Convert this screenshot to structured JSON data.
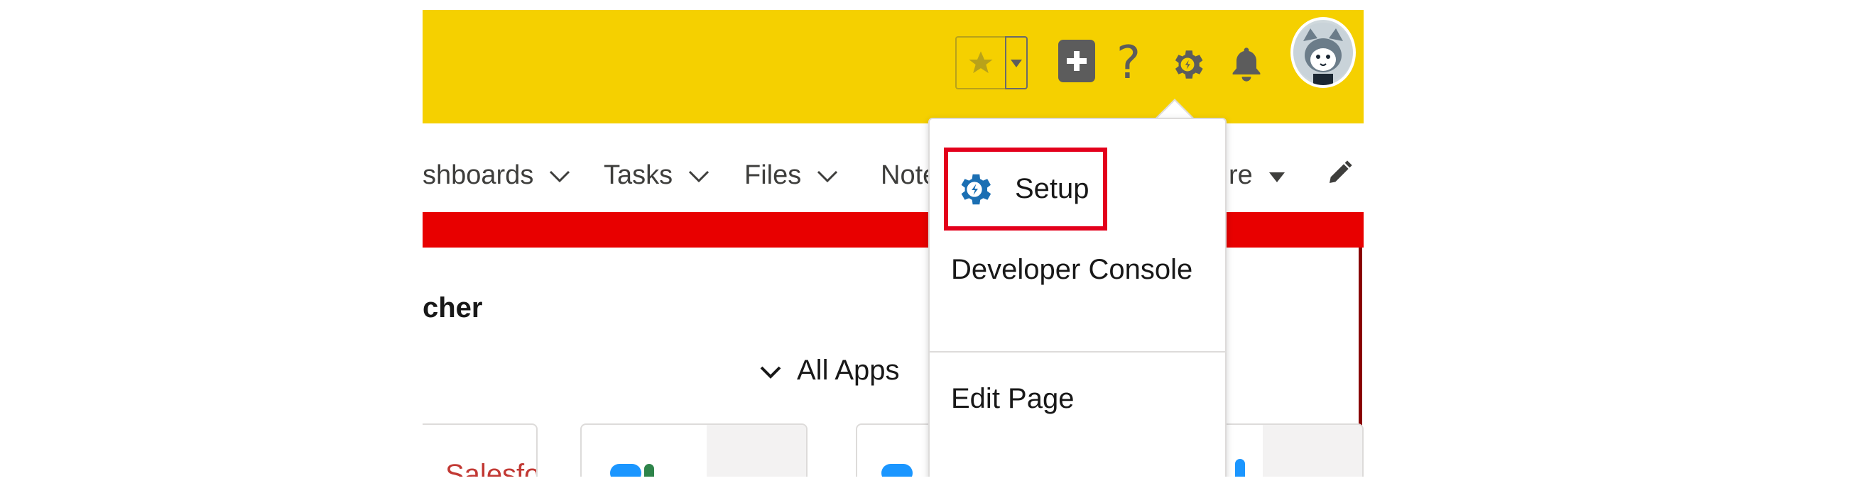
{
  "header": {
    "background_color": "#f5d000",
    "favorites_star_icon": "star-icon",
    "favorites_dropdown_icon": "caret-down-icon",
    "global_actions_icon": "plus-icon",
    "help_icon": "help-icon",
    "help_glyph": "?",
    "setup_gear_icon": "gear-icon",
    "notifications_icon": "bell-icon",
    "avatar_icon": "avatar-icon"
  },
  "nav": {
    "items": [
      {
        "label": "shboards"
      },
      {
        "label": "Tasks"
      },
      {
        "label": "Files"
      },
      {
        "label": "Note"
      },
      {
        "label": "re"
      }
    ],
    "chevron_icon": "chevron-down-icon",
    "edit_icon": "pencil-icon"
  },
  "content": {
    "launcher_title": "cher",
    "all_apps_label": "All Apps",
    "cards": [
      {
        "label": "Salesfo"
      },
      {
        "label": ""
      },
      {
        "label": ""
      }
    ]
  },
  "setup_menu": {
    "items": [
      {
        "label": "Setup",
        "icon": "setup-gear-icon",
        "highlighted": true
      },
      {
        "label": "Developer Console"
      },
      {
        "label": "Edit Page"
      }
    ],
    "highlight_color": "#e3001b"
  },
  "colors": {
    "brand_yellow": "#f5d000",
    "accent_red": "#e80000",
    "setup_icon_blue": "#1b6fb3",
    "icon_gray": "#5c5c5c"
  }
}
